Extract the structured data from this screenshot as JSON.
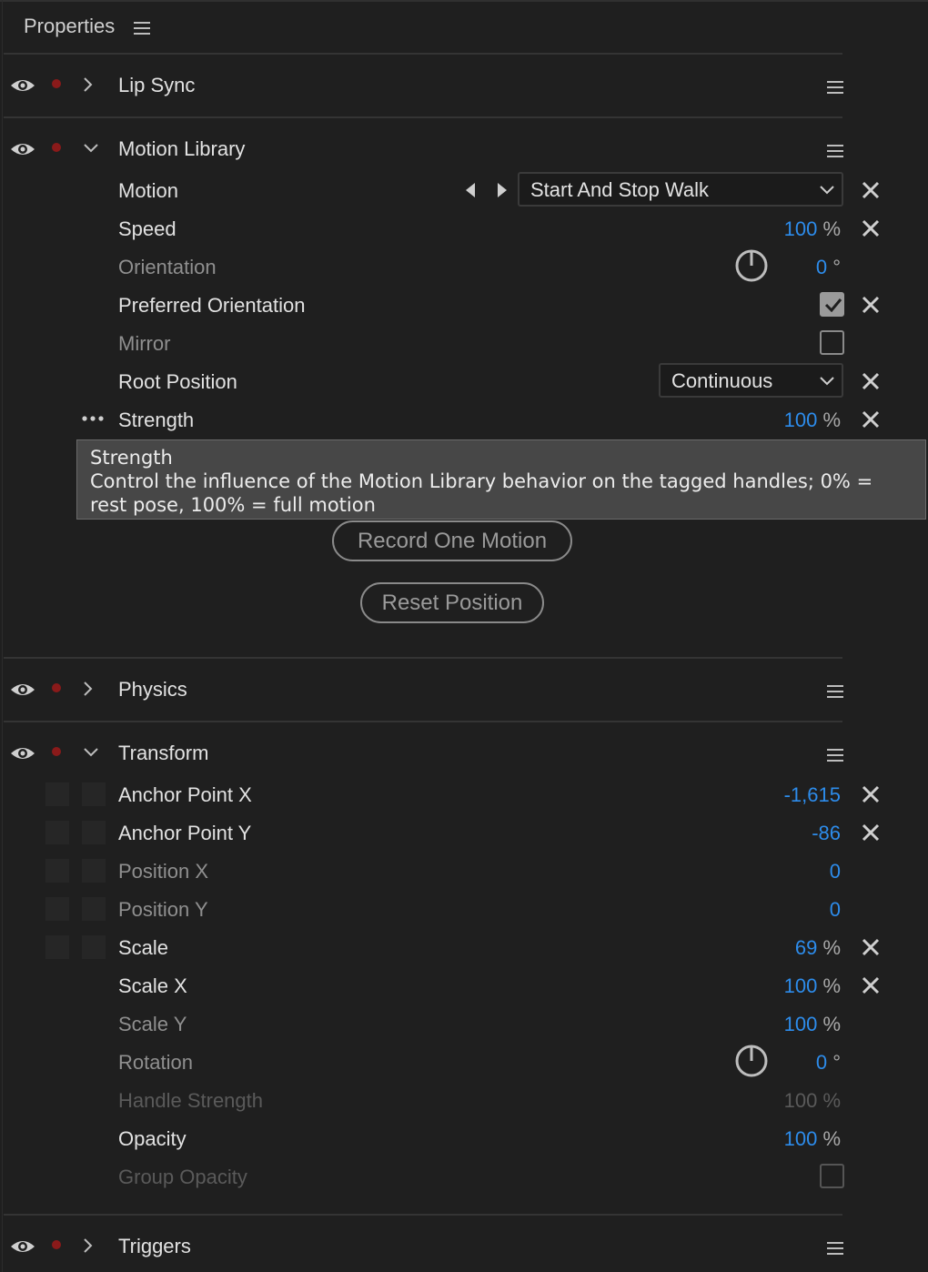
{
  "panel": {
    "title": "Properties"
  },
  "sections": {
    "lip_sync": {
      "label": "Lip Sync"
    },
    "motion_library": {
      "label": "Motion Library",
      "motion": {
        "label": "Motion",
        "selected": "Start And Stop Walk"
      },
      "speed": {
        "label": "Speed",
        "value": "100",
        "unit": "%"
      },
      "orientation": {
        "label": "Orientation",
        "value": "0",
        "unit": "°"
      },
      "preferred_orientation": {
        "label": "Preferred Orientation",
        "checked": true
      },
      "mirror": {
        "label": "Mirror",
        "checked": false
      },
      "root_position": {
        "label": "Root Position",
        "selected": "Continuous"
      },
      "strength": {
        "label": "Strength",
        "value": "100",
        "unit": "%"
      },
      "record_button": "Record One Motion",
      "reset_button": "Reset Position"
    },
    "physics": {
      "label": "Physics"
    },
    "transform": {
      "label": "Transform",
      "anchor_x": {
        "label": "Anchor Point X",
        "value": "-1,615"
      },
      "anchor_y": {
        "label": "Anchor Point Y",
        "value": "-86"
      },
      "position_x": {
        "label": "Position X",
        "value": "0"
      },
      "position_y": {
        "label": "Position Y",
        "value": "0"
      },
      "scale": {
        "label": "Scale",
        "value": "69",
        "unit": "%"
      },
      "scale_x": {
        "label": "Scale X",
        "value": "100",
        "unit": "%"
      },
      "scale_y": {
        "label": "Scale Y",
        "value": "100",
        "unit": "%"
      },
      "rotation": {
        "label": "Rotation",
        "value": "0",
        "unit": "°"
      },
      "handle_strength": {
        "label": "Handle Strength",
        "value": "100",
        "unit": "%"
      },
      "opacity": {
        "label": "Opacity",
        "value": "100",
        "unit": "%"
      },
      "group_opacity": {
        "label": "Group Opacity",
        "checked": false
      }
    },
    "triggers": {
      "label": "Triggers"
    }
  },
  "tooltip": {
    "title": "Strength",
    "body": "Control the influence of the Motion Library behavior on the tagged handles; 0% = rest pose, 100% = full motion"
  },
  "colors": {
    "accent_value": "#2d8ceb",
    "record_dot": "#8a1a1a",
    "background": "#1f1f1f"
  }
}
